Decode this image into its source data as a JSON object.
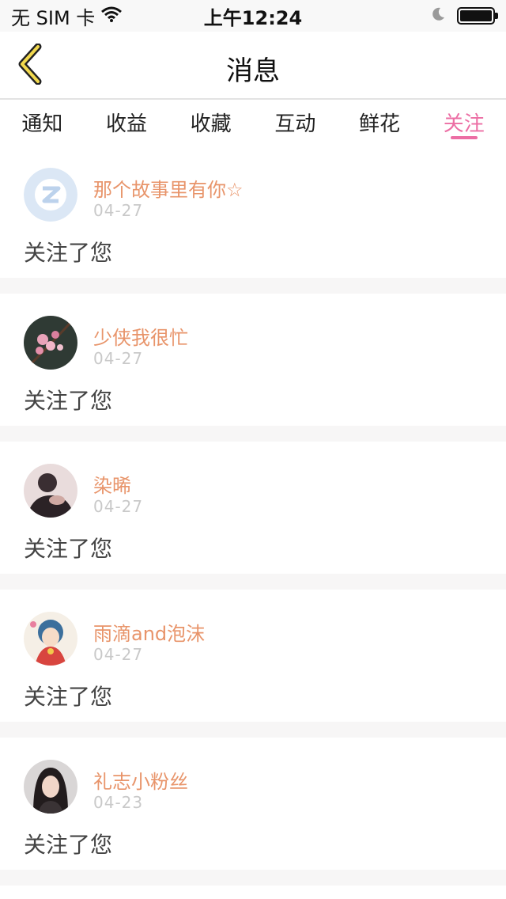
{
  "status_bar": {
    "carrier": "无 SIM 卡",
    "time": "上午12:24",
    "battery_level": 1.0
  },
  "navbar": {
    "title": "消息",
    "back_icon": "chevron-left-icon",
    "accent_color": "#f2d94e"
  },
  "tabs": [
    {
      "label": "通知",
      "active": false
    },
    {
      "label": "收益",
      "active": false
    },
    {
      "label": "收藏",
      "active": false
    },
    {
      "label": "互动",
      "active": false
    },
    {
      "label": "鲜花",
      "active": false
    },
    {
      "label": "关注",
      "active": true
    }
  ],
  "colors": {
    "tab_active": "#ec6ea4",
    "username": "#e8946a",
    "date": "#c9c9c9",
    "separator": "#f7f6f6"
  },
  "messages": [
    {
      "username": "那个故事里有你☆",
      "date": "04-27",
      "text": "关注了您",
      "avatar": "default-avatar-icon"
    },
    {
      "username": "少侠我很忙",
      "date": "04-27",
      "text": "关注了您",
      "avatar": "avatar-plum-blossom"
    },
    {
      "username": "染晞",
      "date": "04-27",
      "text": "关注了您",
      "avatar": "avatar-girl-dark"
    },
    {
      "username": "雨滴and泡沫",
      "date": "04-27",
      "text": "关注了您",
      "avatar": "avatar-anime"
    },
    {
      "username": "礼志小粉丝",
      "date": "04-23",
      "text": "关注了您",
      "avatar": "avatar-portrait"
    }
  ]
}
